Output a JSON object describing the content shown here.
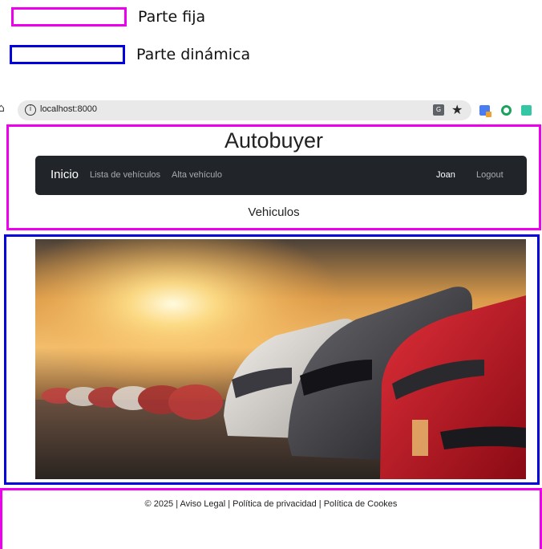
{
  "legend": {
    "fixed_label": "Parte fija",
    "dynamic_label": "Parte dinámica",
    "fixed_color": "#ee00ee",
    "dynamic_color": "#0000dd"
  },
  "browser": {
    "url": "localhost:8000",
    "icons": [
      "home-icon",
      "info-icon",
      "translate-icon",
      "star-icon",
      "extension-icon",
      "grammarly-icon",
      "extension-icon"
    ]
  },
  "header": {
    "site_title": "Autobuyer",
    "navbar_color": "#212529",
    "nav": {
      "brand": "Inicio",
      "links": [
        "Lista de vehículos",
        "Alta vehículo"
      ],
      "user": "Joan",
      "logout": "Logout"
    },
    "section_title": "Vehiculos"
  },
  "main": {
    "hero_image": "photo of a row of cars parked at sunset"
  },
  "footer": {
    "text": "© 2025 | Aviso Legal | Política de privacidad | Política de Cookes"
  }
}
